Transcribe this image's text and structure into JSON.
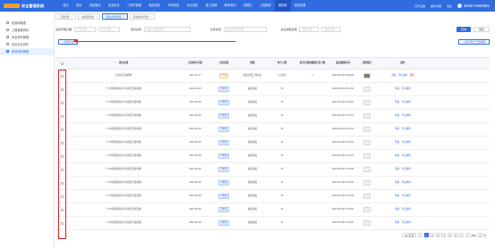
{
  "app": {
    "title": "安全管理系统",
    "user": "测试用户(系统管理员)",
    "links": [
      "打开云屏",
      "操作手册",
      "消息"
    ]
  },
  "nav": [
    "首页",
    "首页",
    "风险管控",
    "安全检查",
    "三同时管理",
    "隐患排查",
    "专项检查",
    "安全巡检",
    "施工管理",
    "教育培训",
    "双预控",
    "工程管理",
    "资料库",
    "检查报表"
  ],
  "nav_active_index": 12,
  "sidebar": [
    {
      "label": "资源库管理",
      "active": false
    },
    {
      "label": "工程管理资料",
      "active": false
    },
    {
      "label": "安全资料管理",
      "active": false
    },
    {
      "label": "综合安全资料",
      "active": false
    },
    {
      "label": "其他资料管理",
      "active": true
    }
  ],
  "tabs": [
    {
      "label": "工程管理",
      "active": false
    },
    {
      "label": "资源库管理",
      "active": false
    },
    {
      "label": "其他资料管理",
      "active": true
    },
    {
      "label": "其他资料管理",
      "active": false
    }
  ],
  "filters": {
    "date_label": "活动开展日期:",
    "date_start": "开始日期",
    "date_end": "结束日期",
    "name_label": "项目名称:",
    "name_placeholder": "请输入项目名称",
    "source_label": "记录来源:",
    "source_placeholder": "请选择记录来源",
    "update_label": "最近编辑日期:",
    "update_start": "开始日期",
    "update_end": "结束日期",
    "search": "查询",
    "reset": "重置"
  },
  "actions": {
    "add": "+ 批量导出",
    "export": "+ 资料导出(已选数据)"
  },
  "table": {
    "headers": [
      "",
      "项目名称",
      "活动举办日期",
      "记录来源",
      "部署",
      "参与人数",
      "填写日期的数据记录人数",
      "最近编辑时间",
      "资料图片",
      "操作"
    ],
    "rows": [
      {
        "name": "东南桥工地机构",
        "date": "2021-01-17",
        "source": "PC端",
        "dept": "防疫方面工作队伍",
        "count": "1 (全部)",
        "people": "1",
        "edit": "2024-09-28 15:08:28",
        "img": true,
        "ops": [
          "查看",
          "导出资料",
          "删除"
        ]
      },
      {
        "name": "广州市国新投资公司项目合资基础",
        "date": "2024-06-28",
        "source": "小程序",
        "dept": "病疫防疫",
        "count": "15",
        "people": "",
        "edit": "2024-06-28 15:14:50",
        "img": false,
        "ops": [
          "查看",
          "导出资料"
        ]
      },
      {
        "name": "广州市国新投资公司项目合资基础",
        "date": "2024-06-28",
        "source": "小程序",
        "dept": "病疫防疫",
        "count": "15",
        "people": "",
        "edit": "2024-06-28 15:14:51",
        "img": false,
        "ops": [
          "查看",
          "导出资料"
        ]
      },
      {
        "name": "广州市国新投资公司项目合资基础",
        "date": "2024-06-28",
        "source": "小程序",
        "dept": "病疫防疫",
        "count": "15",
        "people": "",
        "edit": "2024-06-28 15:14:51",
        "img": false,
        "ops": [
          "查看",
          "导出资料"
        ]
      },
      {
        "name": "广州市国新投资公司项目合资基础",
        "date": "2024-06-28",
        "source": "小程序",
        "dept": "病疫防疫",
        "count": "15",
        "people": "",
        "edit": "2024-06-28 15:14:52",
        "img": false,
        "ops": [
          "查看",
          "导出资料"
        ]
      },
      {
        "name": "广州市国新投资公司项目合资基础",
        "date": "2024-06-28",
        "source": "小程序",
        "dept": "病疫防疫",
        "count": "15",
        "people": "",
        "edit": "2024-06-28 15:14:52",
        "img": false,
        "ops": [
          "查看",
          "导出资料"
        ]
      },
      {
        "name": "广州市国新投资公司项目合资基础",
        "date": "2024-06-28",
        "source": "小程序",
        "dept": "病疫防疫",
        "count": "15",
        "people": "",
        "edit": "2024-06-28 15:14:57",
        "img": false,
        "ops": [
          "查看",
          "导出资料"
        ]
      },
      {
        "name": "广州市国新投资公司项目合资基础",
        "date": "2024-06-28",
        "source": "小程序",
        "dept": "病疫防疫",
        "count": "15",
        "people": "",
        "edit": "2024-06-28 15:14:58",
        "img": false,
        "ops": [
          "查看",
          "导出资料"
        ]
      },
      {
        "name": "广州市国新投资公司项目合资基础",
        "date": "2024-06-28",
        "source": "小程序",
        "dept": "病疫防疫",
        "count": "15",
        "people": "",
        "edit": "2024-06-28 15:14:59",
        "img": false,
        "ops": [
          "查看",
          "导出资料"
        ]
      },
      {
        "name": "广州市国新投资公司项目合资基础",
        "date": "2024-06-28",
        "source": "小程序",
        "dept": "病疫防疫",
        "count": "15",
        "people": "",
        "edit": "2024-06-28 15:14:59",
        "img": false,
        "ops": [
          "查看",
          "导出资料"
        ]
      },
      {
        "name": "广州市国新投资公司项目合资基础",
        "date": "2024-06-28",
        "source": "小程序",
        "dept": "病疫防疫",
        "count": "15",
        "people": "",
        "edit": "2024-06-28 15:15:00",
        "img": false,
        "ops": [
          "查看",
          "导出资料"
        ]
      },
      {
        "name": "广州市国新投资公司项目合资基础",
        "date": "2024-06-28",
        "source": "小程序",
        "dept": "病疫防疫",
        "count": "15",
        "people": "",
        "edit": "2024-06-28 15:15:00",
        "img": false,
        "ops": [
          "查看",
          "导出资料"
        ]
      }
    ]
  },
  "pager": {
    "size": "25 条/页",
    "pages": [
      "<",
      "1",
      "2",
      "3",
      "4",
      "5",
      "6",
      "7",
      ">"
    ],
    "active": "1",
    "goto": "前往",
    "page_unit": "页"
  },
  "colors": {
    "primary": "#2f6cdf",
    "annotation": "#e02020"
  }
}
